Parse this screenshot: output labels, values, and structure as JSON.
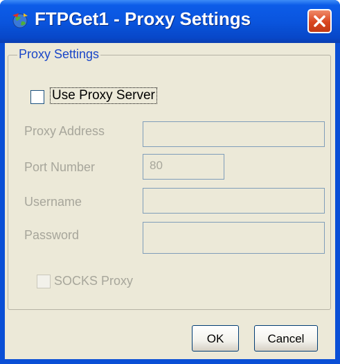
{
  "window": {
    "title": "FTPGet1 - Proxy Settings",
    "icons": {
      "app": "globe-app-icon",
      "close": "close-icon"
    }
  },
  "group": {
    "legend": "Proxy Settings"
  },
  "use_proxy": {
    "label": "Use Proxy Server",
    "checked": false
  },
  "fields": {
    "proxy_address": {
      "label": "Proxy Address",
      "value": ""
    },
    "port_number": {
      "label": "Port Number",
      "value": "80"
    },
    "username": {
      "label": "Username",
      "value": ""
    },
    "password": {
      "label": "Password",
      "value": ""
    }
  },
  "socks": {
    "label": "SOCKS Proxy",
    "checked": false,
    "enabled": false
  },
  "buttons": {
    "ok": "OK",
    "cancel": "Cancel"
  },
  "colors": {
    "titlebar": "#0a55de",
    "client": "#ece9d8",
    "legend_text": "#1a46c8",
    "disabled_text": "#a7a69b",
    "close_button": "#d9451f"
  }
}
